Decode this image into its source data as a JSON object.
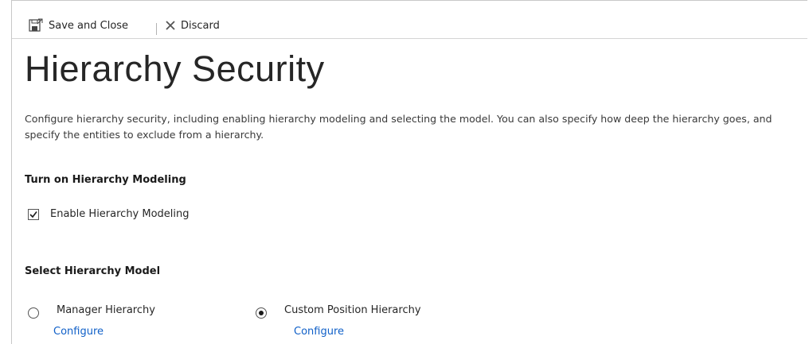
{
  "toolbar": {
    "save_close_label": "Save and Close",
    "save_icon": "save-close-icon",
    "discard_label": "Discard",
    "discard_icon": "discard-x-icon"
  },
  "page": {
    "title": "Hierarchy Security",
    "description": "Configure hierarchy security, including enabling hierarchy modeling and selecting the model. You can also specify how deep the hierarchy goes, and specify the entities to exclude from a hierarchy."
  },
  "modeling": {
    "heading": "Turn on Hierarchy Modeling",
    "enable_label": "Enable Hierarchy Modeling",
    "enable_checked": true
  },
  "model": {
    "heading": "Select Hierarchy Model",
    "options": [
      {
        "label": "Manager Hierarchy",
        "selected": false,
        "configure_label": "Configure"
      },
      {
        "label": "Custom Position Hierarchy",
        "selected": true,
        "configure_label": "Configure"
      }
    ]
  },
  "colors": {
    "link": "#1060c8",
    "text": "#262626",
    "border": "#c8c8c8"
  }
}
